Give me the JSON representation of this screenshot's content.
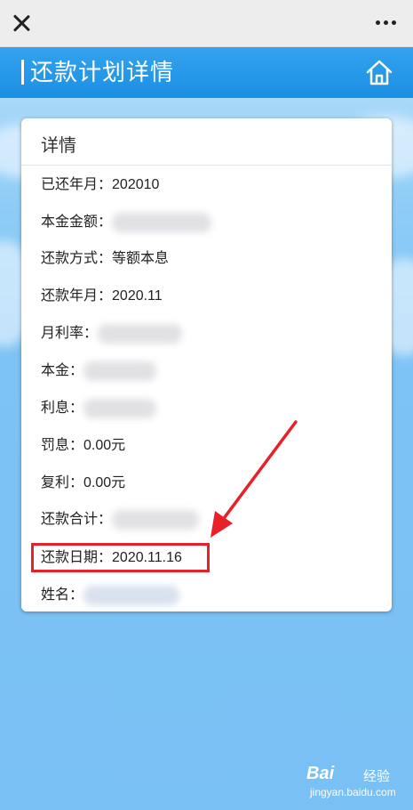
{
  "window": {
    "close_icon": "close-icon",
    "more_icon": "more-dots-icon"
  },
  "header": {
    "title": "还款计划详情",
    "home_icon": "home-icon",
    "color": "#1a8fe3"
  },
  "card": {
    "title": "详情",
    "rows": [
      {
        "label": "已还年月：",
        "value": "202010"
      },
      {
        "label": "本金金额：",
        "value": ""
      },
      {
        "label": "还款方式：",
        "value": "等额本息"
      },
      {
        "label": "还款年月：",
        "value": "2020.11"
      },
      {
        "label": "月利率：",
        "value": ""
      },
      {
        "label": "本金：",
        "value": ""
      },
      {
        "label": "利息：",
        "value": ""
      },
      {
        "label": "罚息：",
        "value": "0.00元"
      },
      {
        "label": "复利：",
        "value": "0.00元"
      },
      {
        "label": "还款合计：",
        "value": ""
      },
      {
        "label": "还款日期：",
        "value": "2020.11.16"
      },
      {
        "label": "姓名：",
        "value": ""
      }
    ]
  },
  "annotation": {
    "highlight_color": "#e8202a"
  },
  "watermark": {
    "brand": "Bai",
    "brand_suffix": "经验",
    "url": "jingyan.baidu.com"
  }
}
